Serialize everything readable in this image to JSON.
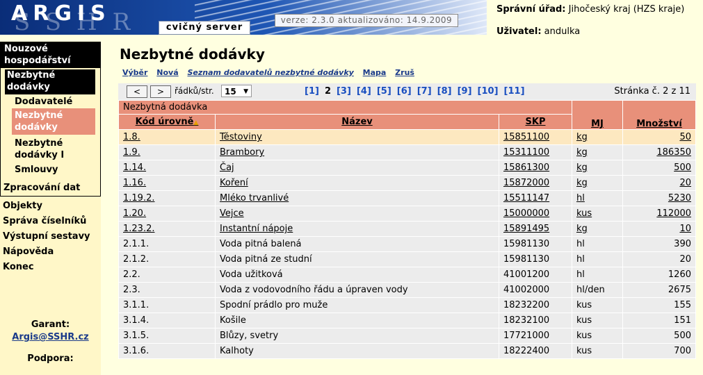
{
  "header": {
    "logo": "ARGIS",
    "logo_background": "SSHR",
    "server": "cvičný server",
    "version": "verze: 2.3.0 aktualizováno: 14.9.2009",
    "office_label": "Správní úřad:",
    "office_value": "Jihočeský kraj (HZS kraje)",
    "user_label": "Uživatel:",
    "user_value": "andulka"
  },
  "sidebar": {
    "nouzove": "Nouzové hospodářství",
    "nezbytne": "Nezbytné dodávky",
    "dodavatele": "Dodavatelé",
    "nezb_dodavky": "Nezbytné dodávky",
    "nezb_dodavky1": "Nezbytné dodávky I",
    "smlouvy": "Smlouvy",
    "zprac": "Zpracování dat",
    "objekty": "Objekty",
    "sprava": "Správa číselníků",
    "vystupni": "Výstupní sestavy",
    "napoveda": "Nápověda",
    "konec": "Konec",
    "garant_label": "Garant:",
    "garant_email": "Argis@SSHR.cz",
    "podpora_label": "Podpora:"
  },
  "main": {
    "title": "Nezbytné dodávky",
    "actions": [
      "Výběr",
      "Nová",
      "Seznam dodavatelů nezbytné dodávky",
      "Mapa",
      "Zruš"
    ]
  },
  "pager": {
    "prev": "<",
    "next": ">",
    "rows_label": "řádků/str.",
    "rows_value": "15",
    "pages": [
      "[1]",
      "2",
      "[3]",
      "[4]",
      "[5]",
      "[6]",
      "[7]",
      "[8]",
      "[9]",
      "[10]",
      "[11]"
    ],
    "current_page": "2",
    "page_info": "Stránka č. 2 z 11"
  },
  "table": {
    "group_header": "Nezbytná dodávka",
    "columns": [
      "Kód úrovně",
      "Název",
      "SKP",
      "MJ",
      "Množství"
    ],
    "rows": [
      [
        "1.8.",
        "Těstoviny",
        "15851100",
        "kg",
        "50"
      ],
      [
        "1.9.",
        "Brambory",
        "15311100",
        "kg",
        "186350"
      ],
      [
        "1.14.",
        "Čaj",
        "15861300",
        "kg",
        "500"
      ],
      [
        "1.16.",
        "Koření",
        "15872000",
        "kg",
        "20"
      ],
      [
        "1.19.2.",
        "Mléko trvanlivé",
        "15511147",
        "hl",
        "5230"
      ],
      [
        "1.20.",
        "Vejce",
        "15000000",
        "kus",
        "112000"
      ],
      [
        "1.23.2.",
        "Instantní nápoje",
        "15891495",
        "kg",
        "10"
      ],
      [
        "2.1.1.",
        "Voda pitná balená",
        "15981130",
        "hl",
        "390"
      ],
      [
        "2.1.2.",
        "Voda pitná ze studní",
        "15981130",
        "hl",
        "20"
      ],
      [
        "2.2.",
        "Voda užitková",
        "41001200",
        "hl",
        "1260"
      ],
      [
        "2.3.",
        "Voda z vodovodního řádu a úpraven vody",
        "41002000",
        "hl/den",
        "2675"
      ],
      [
        "3.1.1.",
        "Spodní prádlo pro muže",
        "18232200",
        "kus",
        "155"
      ],
      [
        "3.1.4.",
        "Košile",
        "18232100",
        "kus",
        "151"
      ],
      [
        "3.1.5.",
        "Blůzy, svetry",
        "17721000",
        "kus",
        "500"
      ],
      [
        "3.1.6.",
        "Kalhoty",
        "18222400",
        "kus",
        "700"
      ]
    ]
  }
}
